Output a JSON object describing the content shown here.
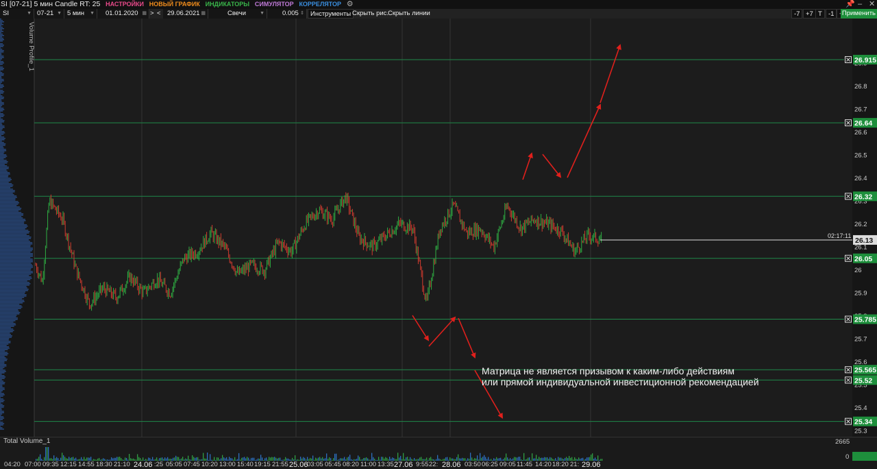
{
  "menu": {
    "title": "SI [07-21] 5 мин Candle RT: 25",
    "items": [
      {
        "label": "НАСТРОЙКИ",
        "color": "#e84a8a"
      },
      {
        "label": "НОВЫЙ ГРАФИК",
        "color": "#f08c1c"
      },
      {
        "label": "ИНДИКАТОРЫ",
        "color": "#39b54a"
      },
      {
        "label": "СИМУЛЯТОР",
        "color": "#c07ad8"
      },
      {
        "label": "КОРРЕЛЯТОР",
        "color": "#3a8fe0"
      }
    ],
    "settings_icon": "gear-icon",
    "pin_icon": "pin-icon",
    "minimize_icon": "minimize-icon",
    "close_icon": "close-icon"
  },
  "toolbar": {
    "symbol": "SI",
    "contract": "07-21",
    "timeframe": "5 мин",
    "date_from": "01.01.2020",
    "nav_back": ">",
    "nav_fwd": "<",
    "date_to": "29.06.2021",
    "chart_type": "Свечи",
    "step": "0.005",
    "tools_label": "Инструменты",
    "hide_drawings_label": "Скрыть рис.",
    "hide_lines_label": "Скрыть линии",
    "btn_m7": "-7",
    "btn_p7": "+7",
    "btn_t": "T",
    "btn_m1": "-1",
    "btn_p1": "+1",
    "apply_label": "Применить"
  },
  "indicator_label": "Volume Profile_1",
  "volume_label": "Total Volume_1",
  "volume_axis": {
    "top": "2665",
    "bottom": "0"
  },
  "time_marker": "02:17:11",
  "disclaimer": {
    "line1": "Матрица не является призывом к каким-либо действиям",
    "line2": "или прямой индивидуальной инвестиционной рекомендацией"
  },
  "colors": {
    "level_line": "#1f8a4a",
    "level_tag": "#1e8f3c",
    "arrow": "#e0201c",
    "candle_up": "#2fb043",
    "candle_down": "#d33b2f"
  },
  "chart_data": {
    "type": "candlestick",
    "y_range": [
      25.27,
      27.0
    ],
    "y_ticks": [
      "26.9",
      "26.8",
      "26.7",
      "26.6",
      "26.5",
      "26.4",
      "26.3",
      "26.2",
      "26.1",
      "26",
      "25.9",
      "25.8",
      "25.7",
      "25.6",
      "25.5",
      "25.4",
      "25.3"
    ],
    "levels": [
      "26.915",
      "26.64",
      "26.32",
      "26.05",
      "25.785",
      "25.565",
      "25.52",
      "25.34"
    ],
    "last_price": "26.13",
    "price_path": [
      [
        0.0,
        26.02
      ],
      [
        0.01,
        25.95
      ],
      [
        0.02,
        26.3
      ],
      [
        0.04,
        26.22
      ],
      [
        0.06,
        26.0
      ],
      [
        0.08,
        25.85
      ],
      [
        0.1,
        25.92
      ],
      [
        0.12,
        25.88
      ],
      [
        0.14,
        25.97
      ],
      [
        0.16,
        25.9
      ],
      [
        0.18,
        25.96
      ],
      [
        0.2,
        25.9
      ],
      [
        0.22,
        26.05
      ],
      [
        0.24,
        26.08
      ],
      [
        0.26,
        26.16
      ],
      [
        0.28,
        26.1
      ],
      [
        0.3,
        25.98
      ],
      [
        0.32,
        26.02
      ],
      [
        0.34,
        26.0
      ],
      [
        0.36,
        26.12
      ],
      [
        0.38,
        26.08
      ],
      [
        0.4,
        26.2
      ],
      [
        0.42,
        26.26
      ],
      [
        0.44,
        26.22
      ],
      [
        0.46,
        26.32
      ],
      [
        0.48,
        26.14
      ],
      [
        0.5,
        26.1
      ],
      [
        0.52,
        26.15
      ],
      [
        0.54,
        26.2
      ],
      [
        0.56,
        26.18
      ],
      [
        0.58,
        25.85
      ],
      [
        0.6,
        26.18
      ],
      [
        0.62,
        26.28
      ],
      [
        0.64,
        26.16
      ],
      [
        0.66,
        26.18
      ],
      [
        0.68,
        26.1
      ],
      [
        0.7,
        26.28
      ],
      [
        0.72,
        26.18
      ],
      [
        0.74,
        26.22
      ],
      [
        0.76,
        26.2
      ],
      [
        0.78,
        26.17
      ],
      [
        0.8,
        26.08
      ],
      [
        0.82,
        26.15
      ],
      [
        0.84,
        26.13
      ]
    ],
    "x_ticks": [
      "04:20",
      "07:00",
      "09:35",
      "12:15",
      "14:55",
      "18:30",
      "21:10",
      "24.06",
      ":25",
      "05:05",
      "07:45",
      "10:20",
      "13:00",
      "15:40",
      "19:15",
      "21:55",
      "25.06",
      "03:05",
      "05:45",
      "08:20",
      "11:00",
      "13:35",
      "27.06",
      "9:55",
      "22:",
      "28.06",
      "03:50",
      "06:25",
      "09:05",
      "11:45",
      "14:20",
      "18:20",
      "21:",
      "29.06"
    ]
  }
}
